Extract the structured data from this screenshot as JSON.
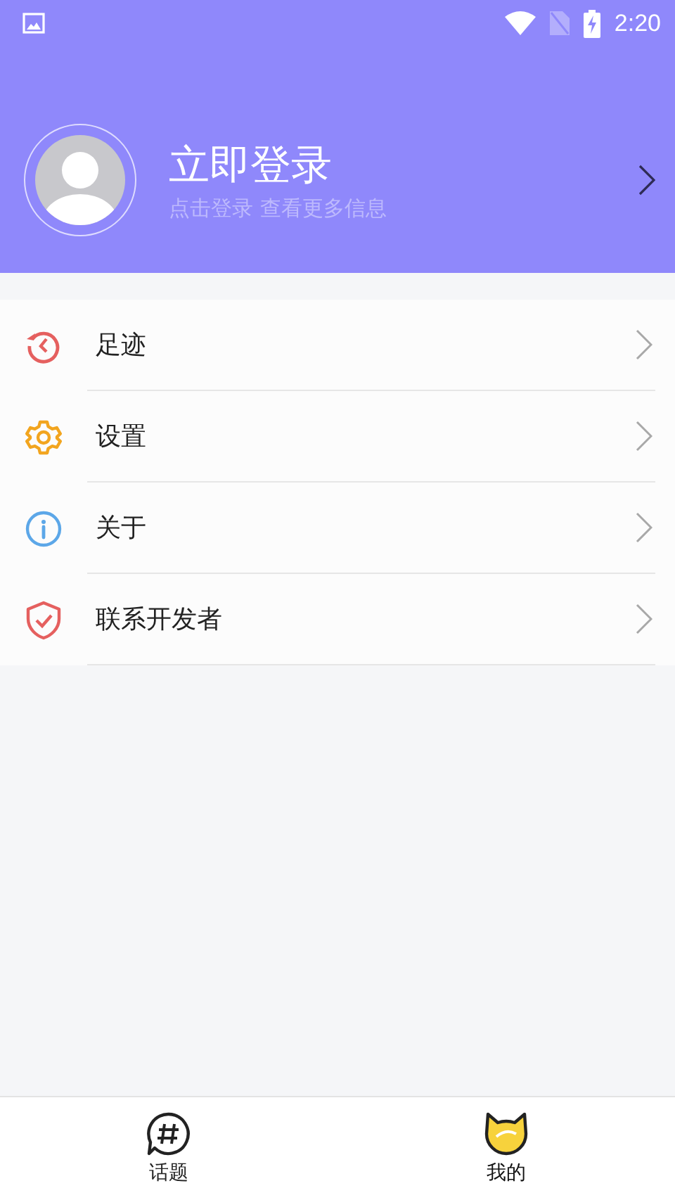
{
  "status_bar": {
    "time": "2:20"
  },
  "profile": {
    "title": "立即登录",
    "subtitle": "点击登录 查看更多信息"
  },
  "menu": [
    {
      "kind": "history",
      "label": "足迹"
    },
    {
      "kind": "settings",
      "label": "设置"
    },
    {
      "kind": "info",
      "label": "关于"
    },
    {
      "kind": "shield",
      "label": "联系开发者"
    }
  ],
  "tabs": [
    {
      "kind": "topic",
      "label": "话题",
      "selected": false
    },
    {
      "kind": "mine",
      "label": "我的",
      "selected": true
    }
  ]
}
